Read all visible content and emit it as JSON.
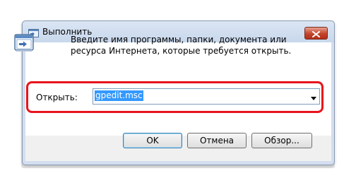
{
  "window": {
    "title": "Выполнить",
    "description": "Введите имя программы, папки, документа или ресурса Интернета, которые требуется открыть."
  },
  "open_field": {
    "label": "Открыть:",
    "value": "gpedit.msc"
  },
  "buttons": {
    "ok": "OK",
    "cancel": "Отмена",
    "browse": "Обзор..."
  },
  "colors": {
    "highlight": "#e8141c",
    "selection": "#3399ff",
    "close_button": "#c3452b"
  },
  "icons": {
    "title": "run-icon",
    "main": "run-icon",
    "close": "close-icon",
    "dropdown": "chevron-down-icon"
  }
}
